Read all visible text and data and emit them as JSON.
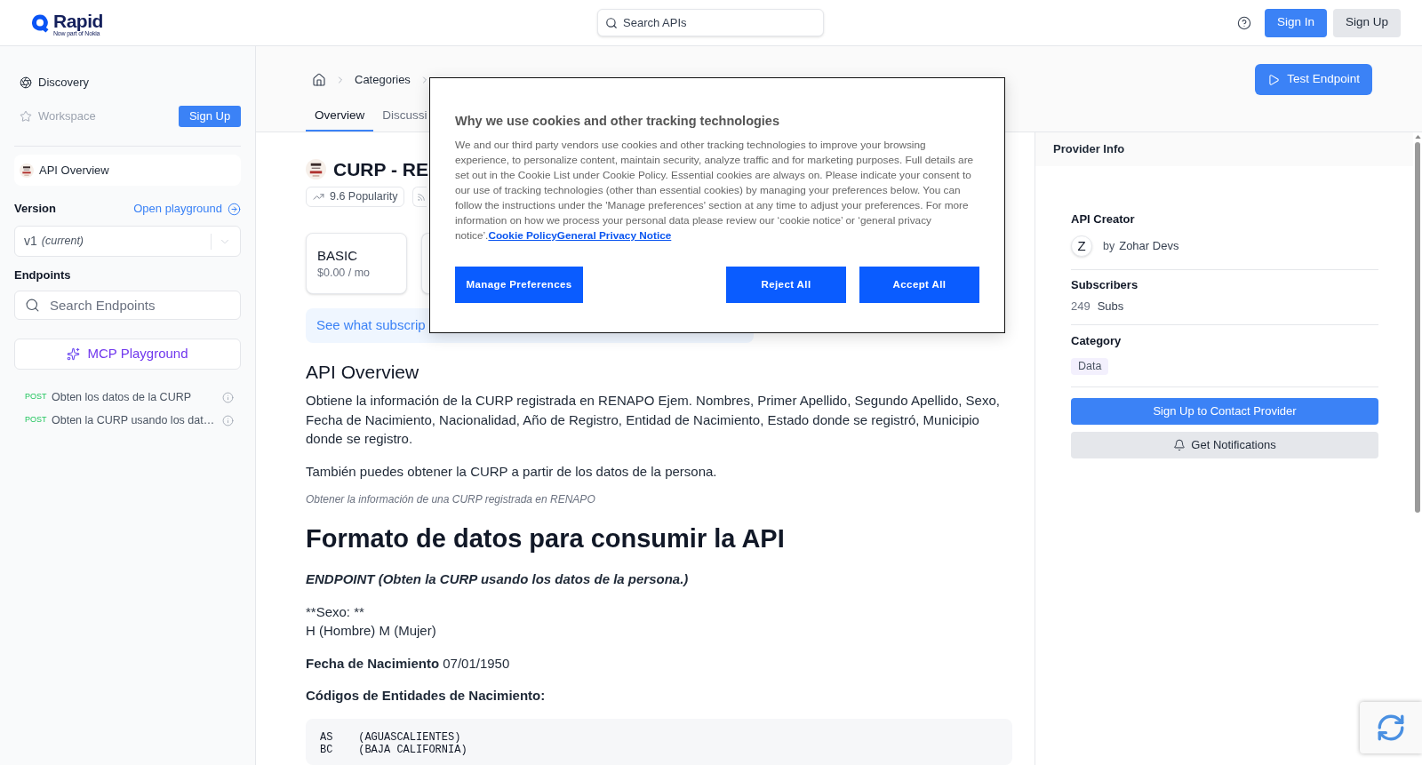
{
  "header": {
    "logo": {
      "name": "Rapid",
      "tagline": "Now part of Nokia"
    },
    "search": {
      "placeholder": "Search APIs"
    },
    "buttons": [
      {
        "label": "Sign In",
        "kind": "primary"
      },
      {
        "label": "Sign Up",
        "kind": "secondary"
      }
    ]
  },
  "sidebar": {
    "nav": [
      {
        "label": "Discovery",
        "disabled": false
      },
      {
        "label": "Workspace",
        "disabled": true,
        "button": "Sign Up"
      }
    ],
    "items": [
      {
        "label": "API Overview",
        "selected": true
      }
    ],
    "version": {
      "label": "Version",
      "link": "Open playground",
      "value": "v1",
      "note": "(current)"
    },
    "endpoints": {
      "label": "Endpoints",
      "search": {
        "placeholder": "Search Endpoints"
      },
      "mcp_button": "MCP Playground",
      "items": [
        {
          "method": "POST",
          "name": "Obten los datos de la CURP"
        },
        {
          "method": "POST",
          "name": "Obten la CURP usando los dat…"
        }
      ]
    }
  },
  "page_header": {
    "breadcrumb": [
      "Categories"
    ],
    "tabs": [
      {
        "label": "Overview",
        "selected": true
      },
      {
        "label": "Discussi",
        "selected": false
      }
    ],
    "action_button": "Test Endpoint"
  },
  "api": {
    "title": "CURP - RE",
    "popularity": "9.6 Popularity",
    "plans": [
      {
        "name": "BASIC",
        "price": "$0.00 / mo"
      }
    ],
    "banner": "See what subscrip"
  },
  "overview": {
    "heading": "API Overview",
    "blocks": [
      {
        "kind": "paragraph",
        "text": "Obtiene la información de la CURP registrada en RENAPO Ejem. Nombres, Primer Apellido, Segundo Apellido, Sexo, Fecha de Nacimiento, Nacionalidad, Año de Registro, Entidad de Nacimiento, Estado donde se registró, Municipio donde se registro."
      },
      {
        "kind": "paragraph",
        "text": "También puedes obtener la CURP a partir de los datos de la persona."
      },
      {
        "kind": "caption",
        "text": "Obtener la información de una CURP registrada en RENAPO"
      },
      {
        "kind": "heading",
        "text": "Formato de datos para consumir la API"
      },
      {
        "kind": "emphasis",
        "text": "ENDPOINT (Obten la CURP usando los datos de la persona.)"
      },
      {
        "kind": "lines",
        "lines": [
          "**Sexo: **",
          "H (Hombre) M (Mujer)"
        ]
      },
      {
        "kind": "paragraph",
        "text": "**Fecha de Nacimiento** 07/01/1950"
      },
      {
        "kind": "label",
        "text": "Códigos de Entidades de Nacimiento:"
      },
      {
        "kind": "code",
        "lines": [
          "AS    (AGUASCALIENTES)",
          "BC    (BAJA CALIFORNIA)"
        ]
      }
    ]
  },
  "provider": {
    "title": "Provider Info",
    "creator": {
      "label": "API Creator",
      "avatar": "Z",
      "prefix": "by",
      "name": "Zohar Devs"
    },
    "subscribers": {
      "label": "Subscribers",
      "count": "249",
      "unit": "Subs"
    },
    "category": {
      "label": "Category",
      "tag": "Data"
    },
    "buttons": [
      {
        "label": "Sign Up to Contact Provider",
        "kind": "primary"
      },
      {
        "label": "Get Notifications",
        "kind": "notify"
      }
    ]
  },
  "cookie_dialog": {
    "title": "Why we use cookies and other tracking technologies",
    "body": "We and our third party vendors use cookies and other tracking technologies to improve your browsing experience, to personalize content, maintain security, analyze traffic and for marketing purposes. Full details are set out in the Cookie List under Cookie Policy. Essential cookies are always on. Please indicate your consent to our use of tracking technologies (other than essential cookies) by managing your preferences below. You can follow the instructions under the 'Manage preferences' section at any time to adjust your preferences. For more information on how we process your personal data please review our ‘cookie notice’ or ‘general privacy notice’.",
    "links": [
      "Cookie Policy",
      "General Privacy Notice"
    ],
    "buttons": [
      {
        "label": "Manage Preferences"
      },
      {
        "label": "Reject All"
      },
      {
        "label": "Accept All"
      }
    ]
  }
}
